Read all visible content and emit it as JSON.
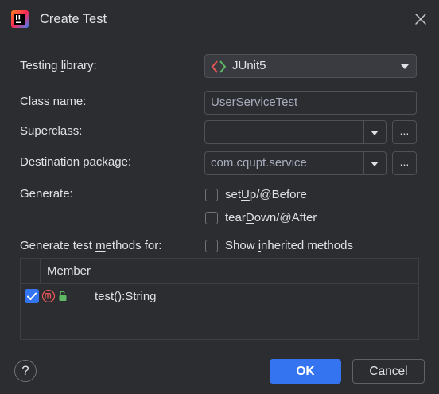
{
  "dialog": {
    "title": "Create Test"
  },
  "form": {
    "testing_library": {
      "label_pre": "Testing ",
      "label_u": "l",
      "label_post": "ibrary:",
      "value": "JUnit5"
    },
    "class_name": {
      "label": "Class name:",
      "value": "UserServiceTest"
    },
    "superclass": {
      "label": "Superclass:",
      "value": "",
      "button": "..."
    },
    "destination_package": {
      "label": "Destination package:",
      "value": "com.cqupt.service",
      "button": "..."
    },
    "generate": {
      "label": "Generate:",
      "setup": {
        "pre": "set",
        "u": "U",
        "post": "p/@Before",
        "checked": false
      },
      "teardown": {
        "pre": "tear",
        "u": "D",
        "post": "own/@After",
        "checked": false
      }
    },
    "methods_for": {
      "label_pre": "Generate test ",
      "label_u": "m",
      "label_post": "ethods for:",
      "show_inherited": {
        "pre": "Show ",
        "u": "i",
        "post": "nherited methods",
        "checked": false
      }
    }
  },
  "table": {
    "column": "Member",
    "rows": [
      {
        "checked": true,
        "text": "test():String"
      }
    ]
  },
  "buttons": {
    "help": "?",
    "ok": "OK",
    "cancel": "Cancel"
  },
  "colors": {
    "background": "#2b2d30",
    "accent": "#3574f0",
    "text": "#dfe1e5",
    "method_icon": "#e55757",
    "lock_icon": "#5fb865"
  }
}
